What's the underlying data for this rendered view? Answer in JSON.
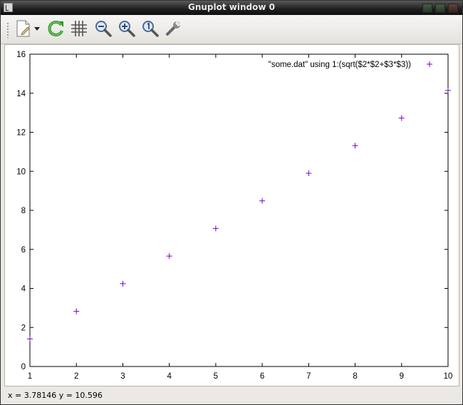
{
  "window": {
    "title": "Gnuplot window 0"
  },
  "toolbar": {
    "buttons": [
      {
        "icon": "export-icon",
        "label": "Export"
      },
      {
        "icon": "export-menu-arrow-icon",
        "label": "Export menu"
      },
      {
        "icon": "replot-icon",
        "label": "Replot"
      },
      {
        "icon": "grid-icon",
        "label": "Toggle grid"
      },
      {
        "icon": "zoom-back-icon",
        "label": "Previous zoom"
      },
      {
        "icon": "zoom-forward-icon",
        "label": "Next zoom"
      },
      {
        "icon": "zoom-reset-icon",
        "label": "Unzoom"
      },
      {
        "icon": "settings-icon",
        "label": "Settings"
      }
    ]
  },
  "status": {
    "text": "x = 3.78146 y = 10.596"
  },
  "colors": {
    "point": "#7a00c8",
    "axis": "#000000"
  },
  "chart_data": {
    "type": "scatter",
    "title": "",
    "xlabel": "",
    "ylabel": "",
    "xlim": [
      1,
      10
    ],
    "ylim": [
      0,
      16
    ],
    "x_ticks": [
      "1",
      "2",
      "3",
      "4",
      "5",
      "6",
      "7",
      "8",
      "9",
      "10"
    ],
    "y_ticks": [
      "0",
      "2",
      "4",
      "6",
      "8",
      "10",
      "12",
      "14",
      "16"
    ],
    "grid": false,
    "legend_position": "top-right",
    "series": [
      {
        "name": "\"some.dat\" using 1:(sqrt($2*$2+$3*$3))",
        "marker": "+",
        "x": [
          1,
          2,
          3,
          4,
          5,
          6,
          7,
          8,
          9,
          10
        ],
        "y": [
          1.414,
          2.828,
          4.243,
          5.657,
          7.071,
          8.485,
          9.899,
          11.314,
          12.728,
          14.142
        ]
      }
    ]
  }
}
